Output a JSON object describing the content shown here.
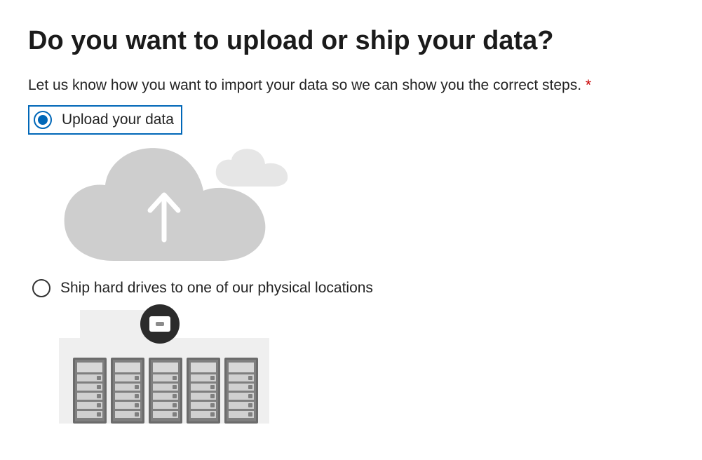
{
  "heading": "Do you want to upload or ship your data?",
  "prompt": "Let us know how you want to import your data so we can show you the correct steps.",
  "required_mark": "*",
  "options": {
    "upload": {
      "label": "Upload your data",
      "selected": true
    },
    "ship": {
      "label": "Ship hard drives to one of our physical locations",
      "selected": false
    }
  }
}
